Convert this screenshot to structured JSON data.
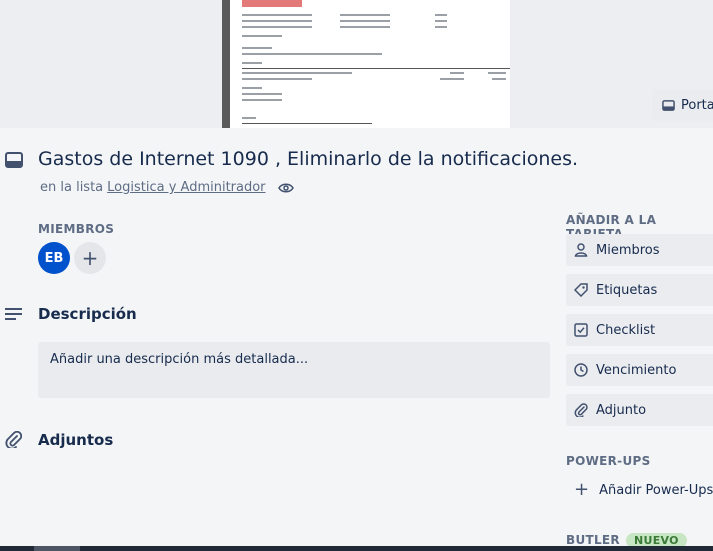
{
  "cover": {
    "button_label": "Porta",
    "icon": "card-cover-icon"
  },
  "card": {
    "title_parts": [
      "Gastos de Internet 1090 , ",
      "Eliminarlo",
      " de la ",
      "notificaciones",
      "."
    ],
    "list_prefix": "en la lista",
    "list_name": "Logistica y Adminitrador",
    "watch_icon": "eye-icon"
  },
  "members": {
    "label": "MIEMBROS",
    "avatar_initials": "EB",
    "avatar_color": "#0052cc",
    "add_symbol": "+"
  },
  "description": {
    "title": "Descripción",
    "placeholder": "Añadir una descripción más detallada..."
  },
  "attachments": {
    "title": "Adjuntos"
  },
  "sidebar": {
    "add_to_card_label": "AÑADIR A LA TARJETA",
    "buttons": [
      {
        "label": "Miembros",
        "icon": "person-icon"
      },
      {
        "label": "Etiquetas",
        "icon": "tag-icon"
      },
      {
        "label": "Checklist",
        "icon": "checkbox-icon"
      },
      {
        "label": "Vencimiento",
        "icon": "clock-icon"
      },
      {
        "label": "Adjunto",
        "icon": "paperclip-icon"
      }
    ],
    "powerups_label": "POWER-UPS",
    "add_powerups": "Añadir Power-Ups",
    "butler_label": "BUTLER",
    "butler_badge": "NUEVO",
    "badge_color": "#c7e6c3"
  }
}
